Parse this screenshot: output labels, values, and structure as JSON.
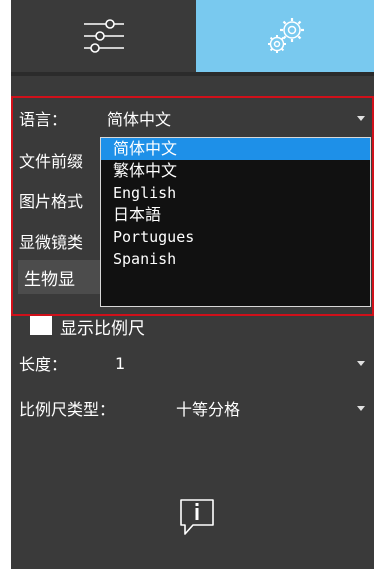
{
  "tabs": [
    {
      "name": "sliders",
      "icon": "sliders-icon",
      "active": false
    },
    {
      "name": "settings",
      "icon": "gears-icon",
      "active": true,
      "color": "#79c9ef"
    }
  ],
  "settings": {
    "language_label": "语言：",
    "language_value": "简体中文",
    "file_prefix_label": "文件前缀",
    "image_format_label": "图片格式",
    "microscope_type_label": "显微镜类",
    "microscope_type_value": "生物显",
    "show_scale_label": "显示比例尺",
    "length_label": "长度：",
    "length_value": "1",
    "scale_type_label": "比例尺类型：",
    "scale_type_value": "十等分格"
  },
  "language_dropdown": {
    "options": [
      "简体中文",
      "繁体中文",
      "English",
      "日本語",
      "Portugues",
      "Spanish"
    ],
    "selected_index": 0
  },
  "colors": {
    "panel": "#3a3a3a",
    "accent": "#79c9ef",
    "selection": "#1e90e8",
    "highlight_frame": "#d0101a"
  }
}
